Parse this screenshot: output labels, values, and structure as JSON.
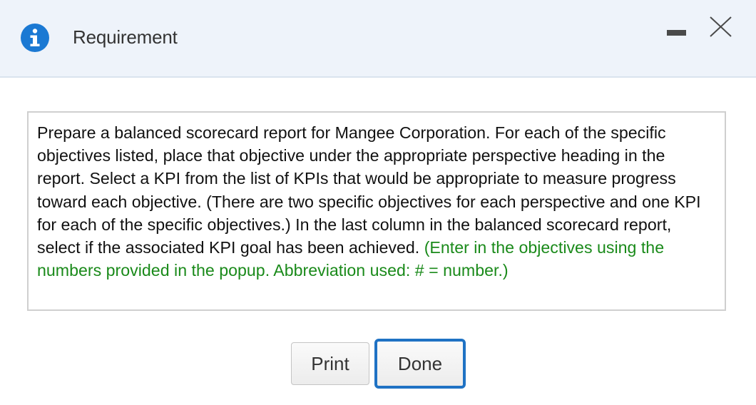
{
  "header": {
    "title": "Requirement"
  },
  "instructions": {
    "main_text": "Prepare a balanced scorecard report for Mangee Corporation. For each of the specific objectives listed, place that objective under the appropriate perspective heading in the report. Select a KPI from the list of KPIs that would be appropriate to measure progress toward each objective. (There are two specific objectives for each perspective and one KPI for each of the specific objectives.) In the last column in the balanced scorecard report, select if the associated KPI goal has been achieved.",
    "note_text": "(Enter in the objectives using the numbers provided in the popup. Abbreviation used: # = number.)"
  },
  "buttons": {
    "print_label": "Print",
    "done_label": "Done"
  },
  "icons": {
    "header_icon": "info-icon",
    "minimize": "minimize-icon",
    "close": "close-icon"
  },
  "colors": {
    "info_icon": "#1b79d3",
    "header_background": "#eef3fa",
    "note_text": "#1a8a1a",
    "done_button_border": "#1f72c4"
  }
}
